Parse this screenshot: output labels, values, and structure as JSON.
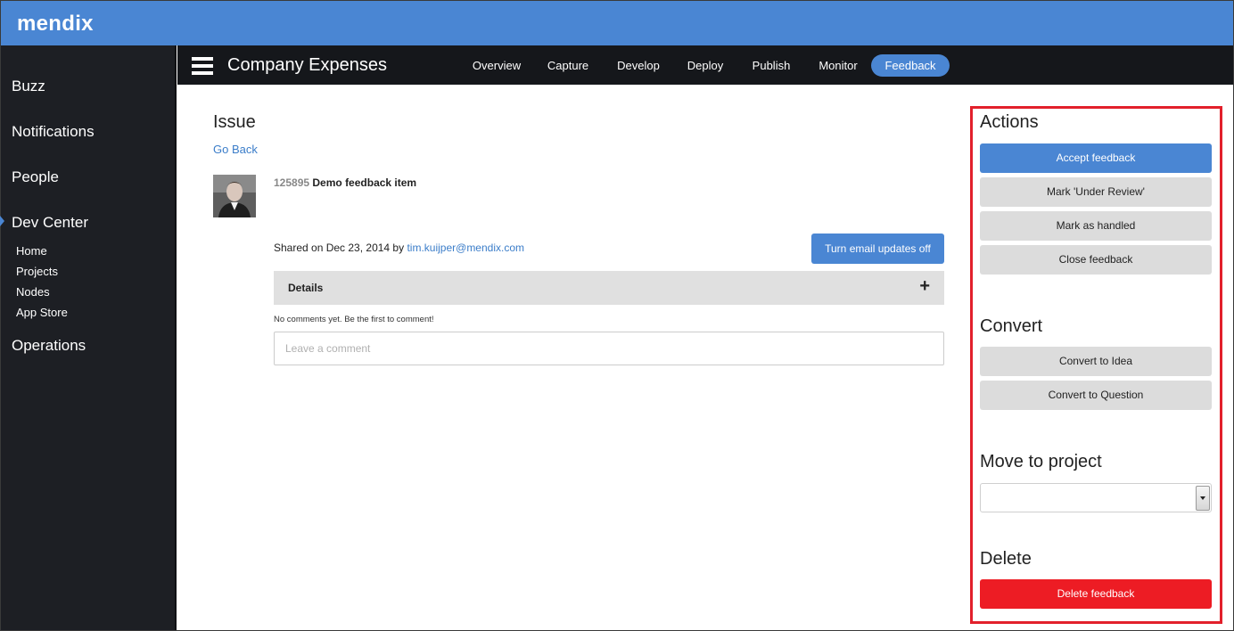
{
  "brand": {
    "logo": "mendix"
  },
  "sidebar": {
    "items": [
      {
        "label": "Buzz"
      },
      {
        "label": "Notifications"
      },
      {
        "label": "People"
      },
      {
        "label": "Dev Center",
        "active": true
      },
      {
        "label": "Operations"
      }
    ],
    "dev_center_sub": [
      {
        "label": "Home"
      },
      {
        "label": "Projects"
      },
      {
        "label": "Nodes"
      },
      {
        "label": "App Store"
      }
    ]
  },
  "project": {
    "title": "Company Expenses",
    "tabs": [
      {
        "label": "Overview"
      },
      {
        "label": "Capture"
      },
      {
        "label": "Develop"
      },
      {
        "label": "Deploy"
      },
      {
        "label": "Publish"
      },
      {
        "label": "Monitor"
      },
      {
        "label": "Feedback",
        "active": true
      }
    ]
  },
  "issue": {
    "heading": "Issue",
    "go_back": "Go Back",
    "id": "125895",
    "title": "Demo feedback item",
    "shared_prefix": "Shared on Dec 23, 2014 by",
    "shared_by": "tim.kuijper@mendix.com",
    "email_button": "Turn email updates off",
    "details_label": "Details",
    "details_toggle": "+",
    "no_comments": "No comments yet. Be the first to comment!",
    "comment_placeholder": "Leave a comment"
  },
  "panel": {
    "actions_heading": "Actions",
    "actions": {
      "accept": "Accept feedback",
      "under_review": "Mark 'Under Review'",
      "handled": "Mark as handled",
      "close": "Close feedback"
    },
    "convert_heading": "Convert",
    "convert": {
      "idea": "Convert to Idea",
      "question": "Convert to Question"
    },
    "move_heading": "Move to project",
    "move_select_value": "",
    "delete_heading": "Delete",
    "delete_button": "Delete feedback"
  },
  "colors": {
    "brand_blue": "#4a86d3",
    "sidebar_bg": "#1d1f24",
    "highlight_red": "#e2202b",
    "danger_red": "#ed1c24"
  }
}
